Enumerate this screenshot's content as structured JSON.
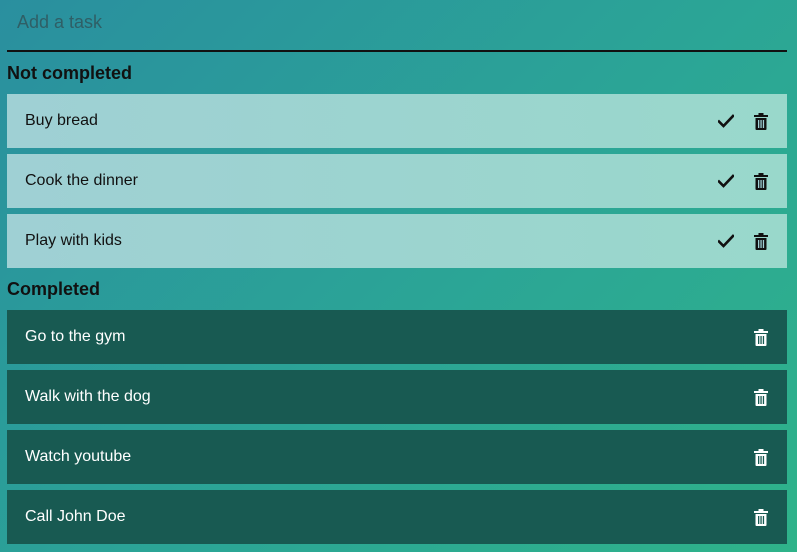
{
  "input": {
    "placeholder": "Add a task",
    "value": ""
  },
  "sections": {
    "not_completed_title": "Not completed",
    "completed_title": "Completed"
  },
  "tasks_not_completed": [
    {
      "label": "Buy bread"
    },
    {
      "label": "Cook the dinner"
    },
    {
      "label": "Play with kids"
    }
  ],
  "tasks_completed": [
    {
      "label": "Go to the gym"
    },
    {
      "label": "Walk with the dog"
    },
    {
      "label": "Watch youtube"
    },
    {
      "label": "Call John Doe"
    }
  ],
  "icons": {
    "complete": "check-icon",
    "delete": "trash-icon"
  },
  "colors": {
    "pending_row": "#9fd0d4",
    "completed_row": "#185a52",
    "background_start": "#2a8f9f",
    "background_end": "#2fb38a"
  }
}
